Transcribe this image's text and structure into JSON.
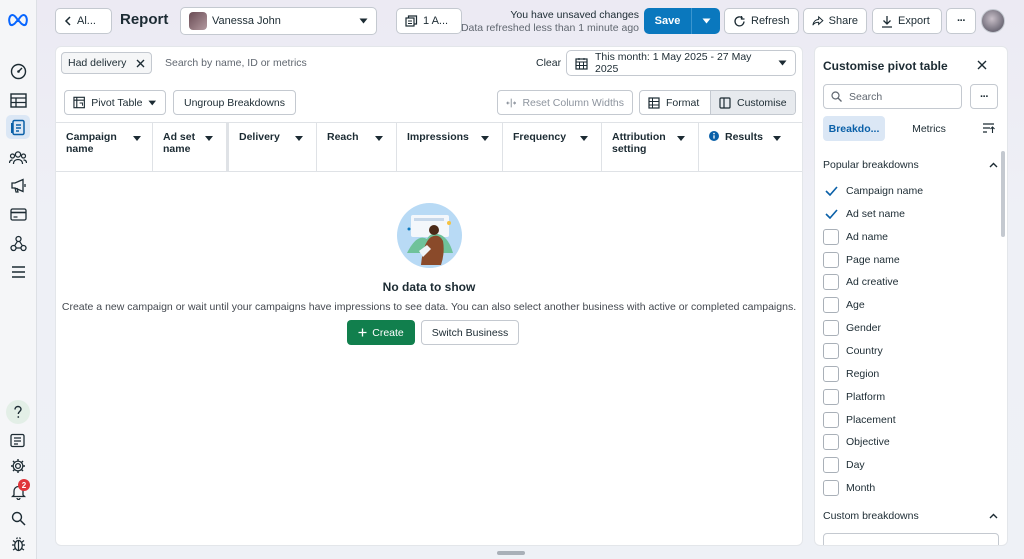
{
  "topbar": {
    "back_label": "Al...",
    "title": "Report",
    "account_name": "Vanessa John",
    "ad_account_label": "1 A...",
    "unsaved_line1": "You have unsaved changes",
    "unsaved_line2": "Data refreshed less than 1 minute ago",
    "save_label": "Save",
    "refresh_label": "Refresh",
    "share_label": "Share",
    "export_label": "Export",
    "more_label": "···"
  },
  "filters": {
    "chip_label": "Had delivery",
    "search_placeholder": "Search by name, ID or metrics",
    "clear_label": "Clear",
    "date_range": "This month: 1 May 2025 - 27 May 2025"
  },
  "toolbar": {
    "pivot_label": "Pivot Table",
    "ungroup_label": "Ungroup Breakdowns",
    "reset_label": "Reset Column Widths",
    "format_label": "Format",
    "customise_label": "Customise"
  },
  "table": {
    "columns": [
      {
        "line1": "Campaign",
        "line2": "name"
      },
      {
        "line1": "Ad set",
        "line2": "name"
      },
      {
        "line1": "Delivery",
        "line2": ""
      },
      {
        "line1": "Reach",
        "line2": ""
      },
      {
        "line1": "Impressions",
        "line2": ""
      },
      {
        "line1": "Frequency",
        "line2": ""
      },
      {
        "line1": "Attribution",
        "line2": "setting"
      },
      {
        "line1": "Results",
        "line2": ""
      }
    ]
  },
  "empty_state": {
    "title": "No data to show",
    "description": "Create a new campaign or wait until your campaigns have impressions to see data. You can also select another business with active or completed campaigns.",
    "create_label": "Create",
    "switch_label": "Switch Business"
  },
  "panel": {
    "title": "Customise pivot table",
    "search_placeholder": "Search",
    "tabs": [
      "Breakdo...",
      "Metrics"
    ],
    "popular_heading": "Popular breakdowns",
    "custom_heading": "Custom breakdowns",
    "breakdowns": [
      {
        "label": "Campaign name",
        "checked": true
      },
      {
        "label": "Ad set name",
        "checked": true
      },
      {
        "label": "Ad name",
        "checked": false
      },
      {
        "label": "Page name",
        "checked": false
      },
      {
        "label": "Ad creative",
        "checked": false
      },
      {
        "label": "Age",
        "checked": false
      },
      {
        "label": "Gender",
        "checked": false
      },
      {
        "label": "Country",
        "checked": false
      },
      {
        "label": "Region",
        "checked": false
      },
      {
        "label": "Platform",
        "checked": false
      },
      {
        "label": "Placement",
        "checked": false
      },
      {
        "label": "Objective",
        "checked": false
      },
      {
        "label": "Day",
        "checked": false
      },
      {
        "label": "Month",
        "checked": false
      }
    ]
  },
  "rail": {
    "notification_count": "2"
  },
  "colors": {
    "primary": "#0a78be",
    "create_green": "#117f4d",
    "badge_red": "#e0353b"
  }
}
